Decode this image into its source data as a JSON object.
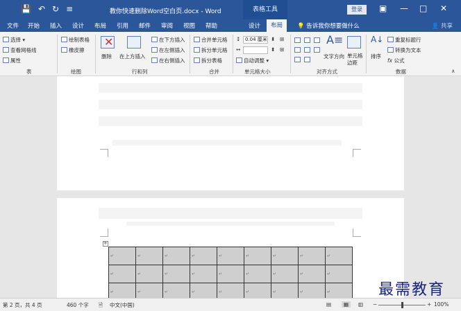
{
  "titlebar": {
    "quick_access": [
      "💾",
      "↶",
      "↻",
      "≡"
    ],
    "title": "教你快速删除Word空白页.docx - Word",
    "context_tab": "表格工具",
    "login": "登录",
    "restore_ribbon": "▣",
    "minimize": "—",
    "maximize": "□",
    "close": "✕"
  },
  "tabs": [
    "文件",
    "开始",
    "插入",
    "设计",
    "布局",
    "引用",
    "邮件",
    "审阅",
    "视图",
    "帮助",
    "设计",
    "布局"
  ],
  "active_tab_index": 11,
  "tell_me": "告诉我你想要做什么",
  "share": "共享",
  "ribbon": {
    "table_group": {
      "select": "选择 ▾",
      "view_gridlines": "查看网格线",
      "properties": "属性",
      "label": "表"
    },
    "draw_group": {
      "draw_table": "绘制表格",
      "eraser": "橡皮擦",
      "label": "绘图"
    },
    "rows_cols_group": {
      "delete": "删除",
      "insert_above": "在上方插入",
      "insert_below": "在下方插入",
      "insert_left": "在左侧插入",
      "insert_right": "在右侧插入",
      "label": "行和列"
    },
    "merge_group": {
      "merge_cells": "合并单元格",
      "split_cells": "拆分单元格",
      "split_table": "拆分表格",
      "label": "合并"
    },
    "cell_size_group": {
      "height_value": "0.04 厘米",
      "autofit": "自动调整 ▾",
      "label": "单元格大小"
    },
    "align_group": {
      "text_direction": "文字方向",
      "cell_margins": "单元格边距",
      "label": "对齐方式"
    },
    "data_group": {
      "sort": "排序",
      "repeat_header": "重复标题行",
      "convert_text": "转换为文本",
      "formula": "公式",
      "label": "数据"
    }
  },
  "table": {
    "rows": 3,
    "cols": 9,
    "cell_mark": "↵"
  },
  "status": {
    "page": "第 2 页，共 4 页",
    "words": "460 个字",
    "language": "中文(中国)",
    "zoom": "100%",
    "zoom_fraction": 0.5
  },
  "watermark": "最需教育"
}
